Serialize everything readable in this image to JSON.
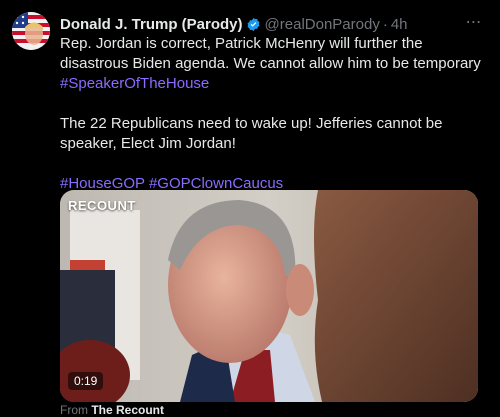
{
  "author": {
    "name": "Donald J. Trump (Parody)",
    "handle": "@realDonParody",
    "separator": "·",
    "time": "4h",
    "verified_color": "#1d9bf0",
    "avatar_icon": "flag-avatar"
  },
  "more_icon": "⋯",
  "post": {
    "line1": "Rep. Jordan is correct, Patrick McHenry will further the disastrous Biden agenda. We cannot allow him to be temporary ",
    "hashtag1": "#SpeakerOfTheHouse",
    "line2": "The 22 Republicans need to wake up! Jefferies cannot be speaker, Elect Jim Jordan!",
    "hashtag2": "#HouseGOP",
    "hashtag3": "#GOPClownCaucus"
  },
  "media": {
    "watermark": "RECOUNT",
    "duration": "0:19"
  },
  "source": {
    "prefix": "From",
    "name": "The Recount"
  },
  "colors": {
    "background": "#000000",
    "hashtag": "#8b6cff",
    "muted": "#71767b"
  }
}
